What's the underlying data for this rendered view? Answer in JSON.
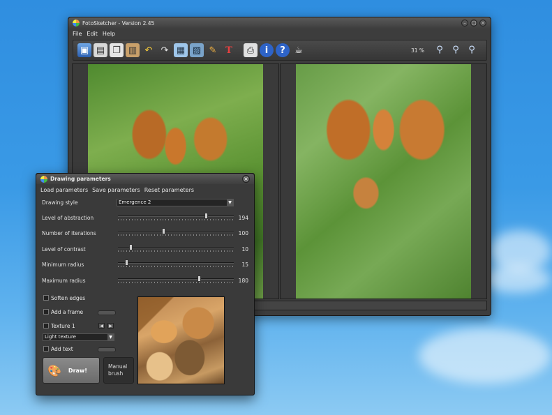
{
  "main_window": {
    "title": "FotoSketcher - Version 2.45",
    "menu": [
      "File",
      "Edit",
      "Help"
    ],
    "zoom": "31 %",
    "toolbar_icons": [
      "open-image-icon",
      "save-icon",
      "copy-icon",
      "paste-icon",
      "undo-icon",
      "redo-icon",
      "resize-icon",
      "crop-icon",
      "drawing-parameters-icon",
      "text-icon",
      "print-icon",
      "info-icon",
      "help-icon",
      "coffee-icon"
    ],
    "zoom_icons": [
      "zoom-in-icon",
      "zoom-fit-icon",
      "zoom-out-icon"
    ]
  },
  "dialog": {
    "title": "Drawing parameters",
    "menu": [
      "Load parameters",
      "Save parameters",
      "Reset parameters"
    ],
    "style_label": "Drawing style",
    "style_value": "Emergence 2",
    "sliders": [
      {
        "label": "Level of abstraction",
        "value": "194",
        "fraction": 0.76
      },
      {
        "label": "Number of iterations",
        "value": "100",
        "fraction": 0.39
      },
      {
        "label": "Level of contrast",
        "value": "10",
        "fraction": 0.11
      },
      {
        "label": "Minimum radius",
        "value": "15",
        "fraction": 0.07
      },
      {
        "label": "Maximum radius",
        "value": "180",
        "fraction": 0.7
      }
    ],
    "checkboxes": {
      "soften_edges": "Soften edges",
      "add_frame": "Add a frame",
      "texture": "Texture 1",
      "add_text": "Add text"
    },
    "texture_select": "Light texture",
    "draw_button": "Draw!",
    "manual_button_line1": "Manual",
    "manual_button_line2": "brush"
  }
}
